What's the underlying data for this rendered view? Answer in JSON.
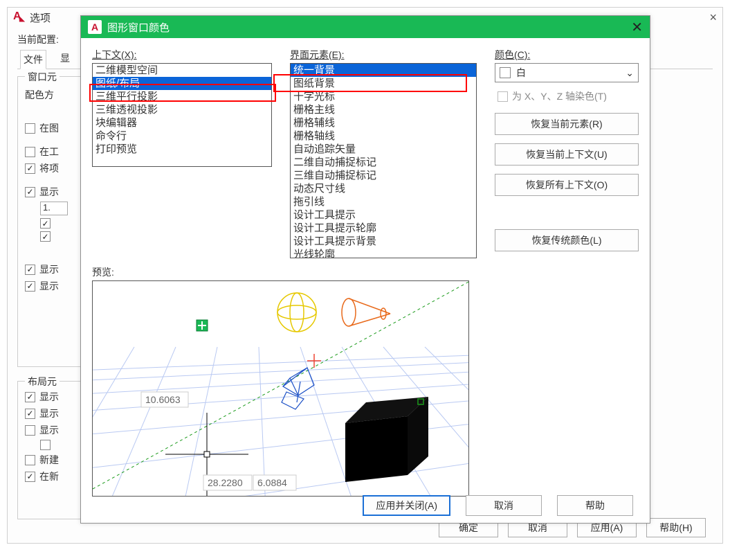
{
  "parent": {
    "title": "选项",
    "current_config_label": "当前配置:",
    "tabs": {
      "file": "文件",
      "display": "显"
    },
    "window_section": {
      "title": "窗口元",
      "color_scheme_label": "配色方",
      "chk_in_b": "在图",
      "chk_in_g": "在工",
      "chk_jiangx": "将项",
      "chk_xianshi1": "显示",
      "num_value": "1.",
      "chk_xianshi2": "显示",
      "chk_xianshi3": "显示"
    },
    "layout_section": {
      "title": "布局元",
      "chk1": "显示",
      "chk2": "显示",
      "chk3": "显示",
      "chk4": "新建",
      "chk5": "在新"
    },
    "buttons": {
      "ok": "确定",
      "cancel": "取消",
      "apply": "应用(A)",
      "help": "帮助(H)"
    }
  },
  "dialog": {
    "title": "图形窗口颜色",
    "context_label": "上下文(X):",
    "element_label": "界面元素(E):",
    "color_label": "颜色(C):",
    "context_items": [
      "二维模型空间",
      "图纸/布局",
      "三维平行投影",
      "三维透视投影",
      "块编辑器",
      "命令行",
      "打印预览"
    ],
    "context_selected": 1,
    "element_items": [
      "统一背景",
      "图纸背景",
      "十字光标",
      "栅格主线",
      "栅格辅线",
      "栅格轴线",
      "自动追踪矢量",
      "二维自动捕捉标记",
      "三维自动捕捉标记",
      "动态尺寸线",
      "拖引线",
      "设计工具提示",
      "设计工具提示轮廓",
      "设计工具提示背景",
      "光线轮廓"
    ],
    "element_selected": 0,
    "color_value": "白",
    "tint_label": "为 X、Y、Z 轴染色(T)",
    "restore_current_element": "恢复当前元素(R)",
    "restore_current_context": "恢复当前上下文(U)",
    "restore_all_contexts": "恢复所有上下文(O)",
    "restore_legacy_colors": "恢复传统颜色(L)",
    "preview_label": "预览:",
    "preview_values": {
      "y": "10.6063",
      "x": "28.2280",
      "z": "6.0884"
    },
    "buttons": {
      "apply_close": "应用并关闭(A)",
      "cancel": "取消",
      "help": "帮助"
    }
  }
}
